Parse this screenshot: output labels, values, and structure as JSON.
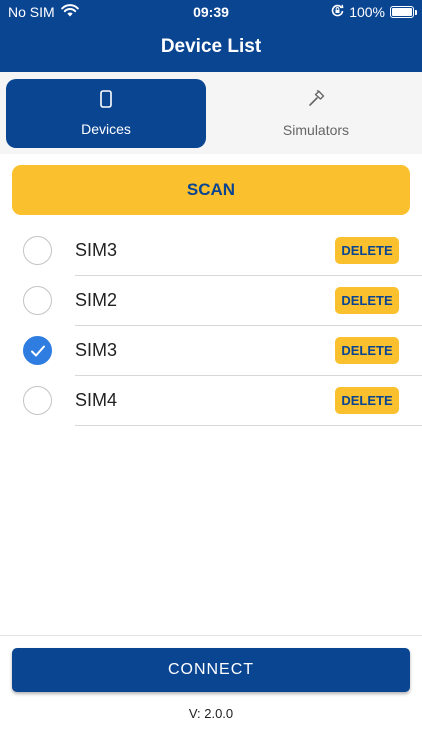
{
  "status_bar": {
    "carrier": "No SIM",
    "time": "09:39",
    "battery": "100%",
    "icons": [
      "wifi-icon",
      "orientation-lock-icon",
      "battery-icon"
    ]
  },
  "header": {
    "title": "Device List"
  },
  "tabs": [
    {
      "label": "Devices",
      "icon": "phone-icon",
      "active": true
    },
    {
      "label": "Simulators",
      "icon": "hammer-icon",
      "active": false
    }
  ],
  "scan_label": "SCAN",
  "devices": [
    {
      "name": "SIM3",
      "selected": false,
      "delete_label": "DELETE"
    },
    {
      "name": "SIM2",
      "selected": false,
      "delete_label": "DELETE"
    },
    {
      "name": "SIM3",
      "selected": true,
      "delete_label": "DELETE"
    },
    {
      "name": "SIM4",
      "selected": false,
      "delete_label": "DELETE"
    }
  ],
  "connect_label": "CONNECT",
  "version": "V: 2.0.0",
  "colors": {
    "primary": "#0a4592",
    "accent": "#fbc02d",
    "radio_checked": "#2f7de1"
  }
}
